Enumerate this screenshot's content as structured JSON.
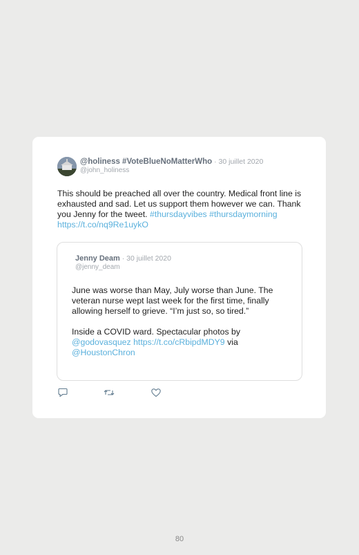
{
  "tweet": {
    "display_name": "@holiness #VoteBlueNoMatterWho",
    "date": " · 30 juillet 2020",
    "handle": "@john_holiness",
    "text": "This should be preached all over the country. Medical front line is exhausted and sad. Let us support them however we can. Thank you Jenny for the tweet. ",
    "hashtag1": "#thursdayvibes",
    "hashtag2": "#thursdaymorning",
    "link": "https://t.co/nq9Re1uykO"
  },
  "quoted": {
    "display_name": "Jenny Deam",
    "date": " · 30 juillet 2020",
    "handle": "@jenny_deam",
    "para1": "June was worse than May, July worse than June. The veteran nurse wept last week for the first time, finally allowing herself to grieve. “I’m just so, so tired.”",
    "para2_text": "Inside a COVID ward. Spectacular photos by ",
    "mention1": "@godovasquez",
    "link": "https://t.co/cRbipdMDY9",
    "via": " via ",
    "mention2": "@HoustonChron"
  },
  "icons": [
    "reply-icon",
    "retweet-icon",
    "like-icon"
  ],
  "colors": {
    "link": "#5ab0dc",
    "background": "#ebebea",
    "card": "#ffffff"
  },
  "page_number": "80"
}
